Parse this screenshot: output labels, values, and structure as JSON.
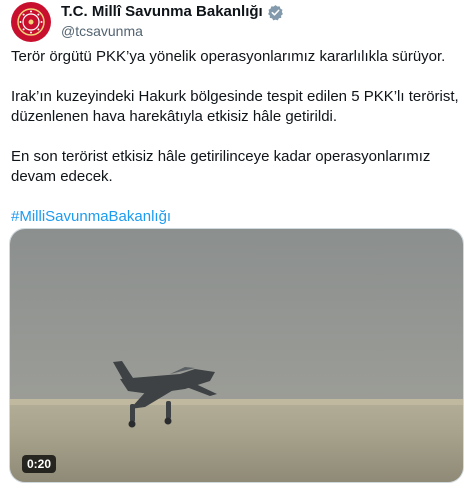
{
  "account": {
    "display_name": "T.C. Millî Savunma Bakanlığı",
    "handle": "@tcsavunma",
    "avatar_color": "#c8102e",
    "verified_icon": "verified-badge-icon",
    "verified_color": "#829aab"
  },
  "tweet": {
    "paragraphs": [
      "Terör örgütü PKK’ya yönelik operasyonlarımız kararlılıkla sürüyor.",
      "Irak’ın kuzeyindeki Hakurk bölgesinde tespit edilen 5 PKK’lı terörist, düzenlenen hava harekâtıyla etkisiz hâle getirildi.",
      "En son terörist etkisiz hâle getirilinceye kadar operasyonlarımız devam edecek."
    ],
    "hashtag": "#MilliSavunmaBakanlığı",
    "hashtag_color": "#1d9bf0"
  },
  "media": {
    "type": "video",
    "duration": "0:20",
    "subject": "jet-aircraft-takeoff"
  }
}
